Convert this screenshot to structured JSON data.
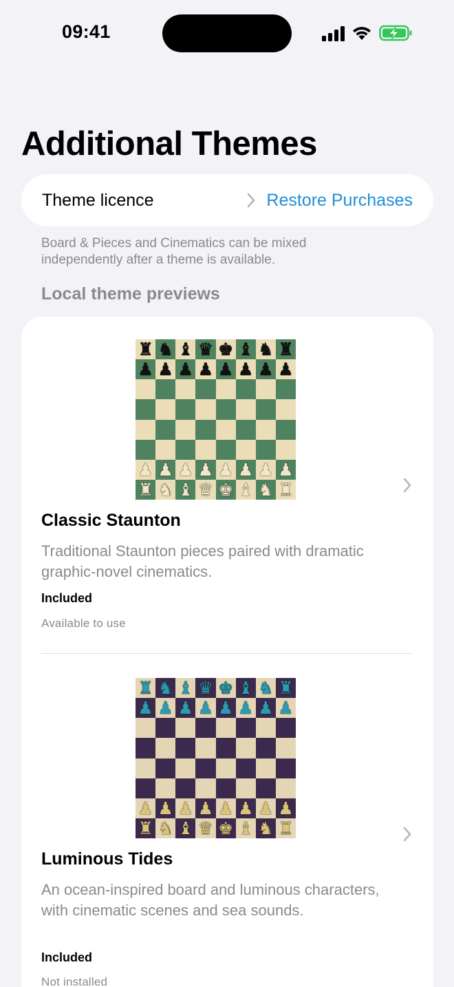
{
  "status_bar": {
    "time": "09:41"
  },
  "header": {
    "title": "Additional Themes"
  },
  "licence": {
    "label": "Theme licence",
    "restore_label": "Restore Purchases",
    "link_color": "#1E8FD8"
  },
  "footnote": "Board & Pieces and Cinematics can be mixed independently after a theme is available.",
  "section": {
    "title": "Local theme previews"
  },
  "themes": [
    {
      "name": "Classic Staunton",
      "description": "Traditional Staunton pieces paired with dramatic graphic-novel cinematics.",
      "status": "Included",
      "availability": "Available to use",
      "board": {
        "light": "#EBDDB8",
        "dark": "#4F8360",
        "black_piece_color": "#111111",
        "white_piece_color": "#F2E6C6",
        "back_rank": [
          "♜",
          "♞",
          "♝",
          "♛",
          "♚",
          "♝",
          "♞",
          "♜"
        ],
        "pawn": "♟"
      }
    },
    {
      "name": "Luminous Tides",
      "description": "An ocean-inspired board and luminous characters, with cinematic scenes and sea sounds.",
      "status": "Included",
      "availability": "Not installed",
      "board": {
        "light": "#E4D6B4",
        "dark": "#3B2A4D",
        "black_piece_color": "#2A9BB0",
        "white_piece_color": "#D9C27A",
        "back_rank": [
          "♜",
          "♞",
          "♝",
          "♛",
          "♚",
          "♝",
          "♞",
          "♜"
        ],
        "pawn": "♟"
      }
    }
  ]
}
